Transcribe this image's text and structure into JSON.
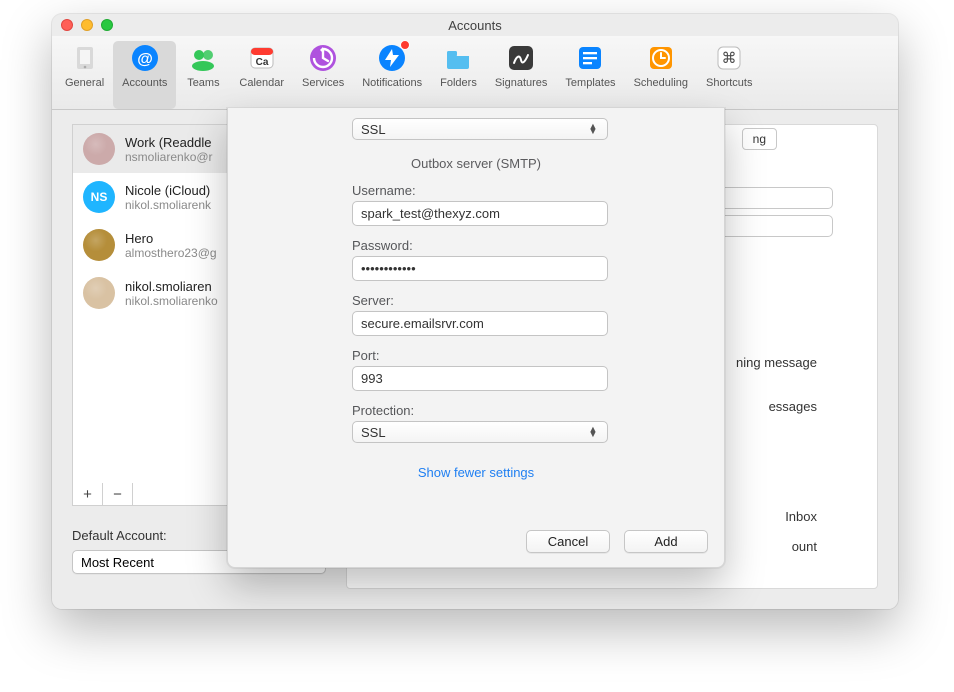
{
  "window": {
    "title": "Accounts"
  },
  "toolbar": [
    {
      "label": "General",
      "icon": "general",
      "selected": false
    },
    {
      "label": "Accounts",
      "icon": "accounts",
      "selected": true
    },
    {
      "label": "Teams",
      "icon": "teams",
      "selected": false
    },
    {
      "label": "Calendar",
      "icon": "calendar",
      "selected": false
    },
    {
      "label": "Services",
      "icon": "services",
      "selected": false
    },
    {
      "label": "Notifications",
      "icon": "notifications",
      "selected": false,
      "badge": true
    },
    {
      "label": "Folders",
      "icon": "folders",
      "selected": false
    },
    {
      "label": "Signatures",
      "icon": "signatures",
      "selected": false
    },
    {
      "label": "Templates",
      "icon": "templates",
      "selected": false
    },
    {
      "label": "Scheduling",
      "icon": "scheduling",
      "selected": false
    },
    {
      "label": "Shortcuts",
      "icon": "shortcuts",
      "selected": false
    }
  ],
  "accounts": [
    {
      "name": "Work (Readdle",
      "email": "nsmoliarenko@r",
      "avatar": {
        "type": "photo",
        "bg": "#caa"
      },
      "selected": true
    },
    {
      "name": "Nicole (iCloud)",
      "email": "nikol.smoliarenk",
      "avatar": {
        "type": "initials",
        "text": "NS",
        "bg": "#1fb5ff"
      },
      "selected": false
    },
    {
      "name": "Hero",
      "email": "almosthero23@g",
      "avatar": {
        "type": "photo",
        "bg": "#b58e3a"
      },
      "selected": false
    },
    {
      "name": "nikol.smoliaren",
      "email": "nikol.smoliarenko",
      "avatar": {
        "type": "photo",
        "bg": "#d9c2a3"
      },
      "selected": false
    }
  ],
  "sidebar_buttons": {
    "add": "+",
    "remove": "−"
  },
  "default_account": {
    "label": "Default Account:",
    "value": "Most Recent"
  },
  "right_panel": {
    "pill": "ng",
    "text1": "ning message",
    "text2": "essages",
    "text3": "Inbox",
    "text4": "ount"
  },
  "modal": {
    "top_select": "SSL",
    "section": "Outbox server (SMTP)",
    "username_label": "Username:",
    "username": "spark_test@thexyz.com",
    "password_label": "Password:",
    "password": "••••••••••••",
    "server_label": "Server:",
    "server": "secure.emailsrvr.com",
    "port_label": "Port:",
    "port": "993",
    "protection_label": "Protection:",
    "protection": "SSL",
    "show_less": "Show fewer settings",
    "cancel": "Cancel",
    "add": "Add"
  },
  "icon_colors": {
    "general": "#bfbfbf",
    "accounts": "#0a84ff",
    "teams": "#34c759",
    "calendar": "#ff3b30",
    "services": "#af52de",
    "notifications": "#0a84ff",
    "folders": "#55bef0",
    "signatures": "#3a3a3a",
    "templates": "#0a84ff",
    "scheduling": "#ff9500",
    "shortcuts": "#4a4a4a"
  }
}
